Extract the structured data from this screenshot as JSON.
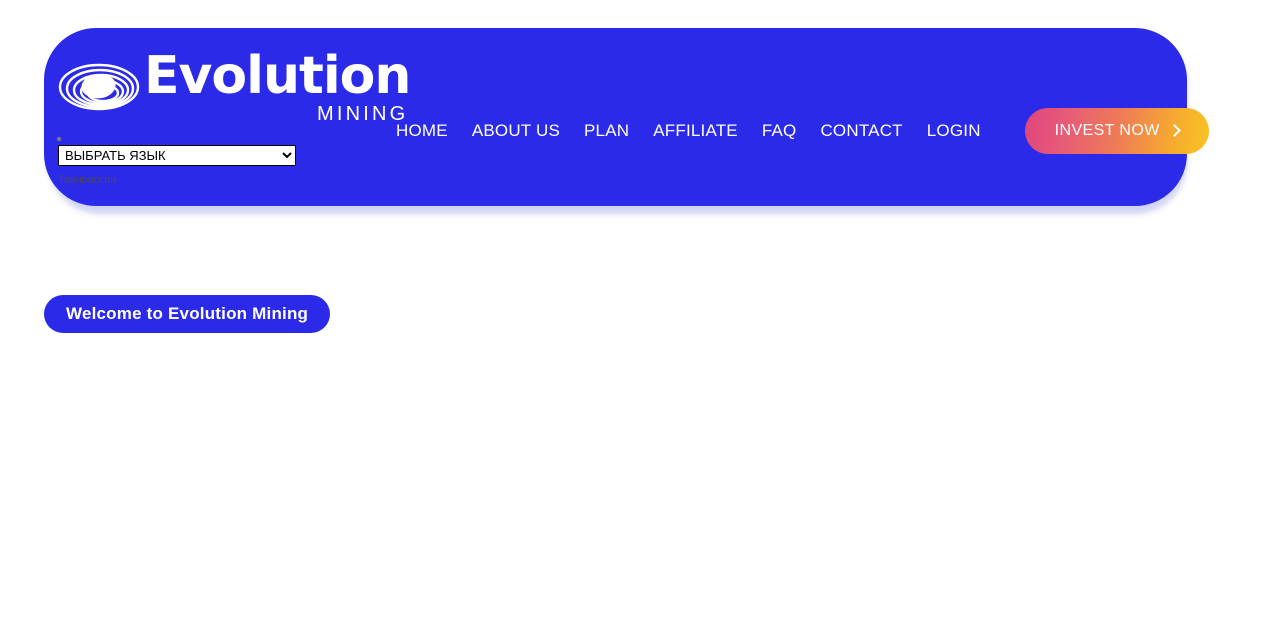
{
  "brand": {
    "name": "Evolution",
    "subtitle": "MINING",
    "logo_icon": "spiral-rings-logo-icon",
    "color": "#2a2ae8"
  },
  "nav": {
    "items": [
      {
        "label": "HOME",
        "name": "nav-home"
      },
      {
        "label": "ABOUT US",
        "name": "nav-about-us"
      },
      {
        "label": "PLAN",
        "name": "nav-plan"
      },
      {
        "label": "AFFILIATE",
        "name": "nav-affiliate"
      },
      {
        "label": "FAQ",
        "name": "nav-faq"
      },
      {
        "label": "CONTACT",
        "name": "nav-contact"
      },
      {
        "label": "LOGIN",
        "name": "nav-login"
      }
    ],
    "cta": {
      "label": "INVEST NOW",
      "icon": "chevron-right-icon",
      "gradient_from": "#e0457a",
      "gradient_to": "#f9c423"
    }
  },
  "language_widget": {
    "bullet_icon": "bullet-dot-icon",
    "selected": "ВЫБРАТЬ ЯЗЫК",
    "options": [
      "ВЫБРАТЬ ЯЗЫК"
    ],
    "footnote": "Технологии"
  },
  "hero": {
    "welcome_badge": "Welcome to Evolution Mining"
  }
}
